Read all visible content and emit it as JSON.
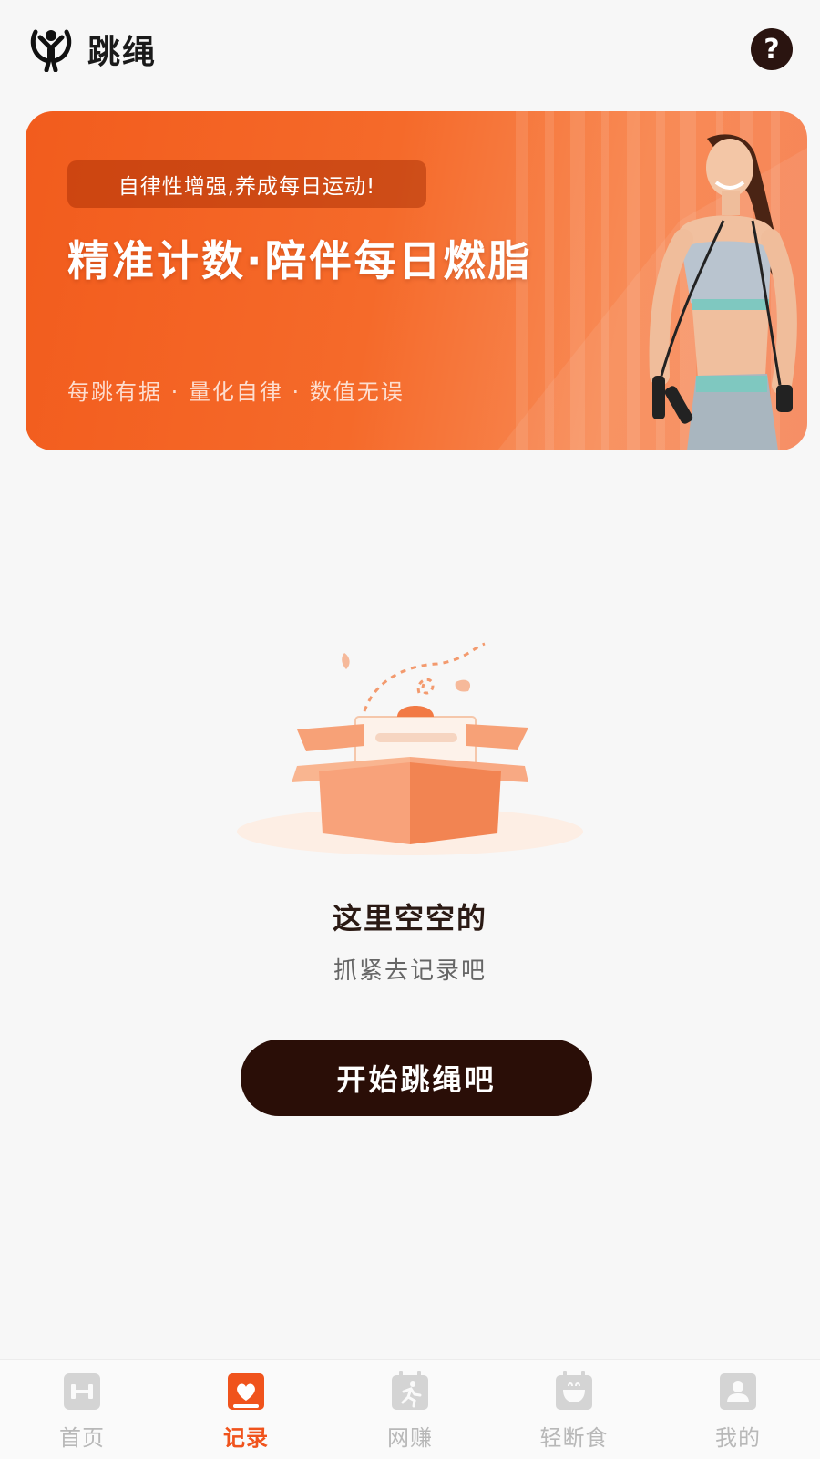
{
  "header": {
    "title": "跳绳",
    "logo_icon": "jump-rope-person-icon",
    "help_icon": "question-icon",
    "help_glyph": "?"
  },
  "banner": {
    "pill_text": "自律性增强,养成每日运动!",
    "headline": "精准计数·陪伴每日燃脂",
    "subline": "每跳有据 · 量化自律 · 数值无误",
    "accent_color": "#f25c1d"
  },
  "empty_state": {
    "title": "这里空空的",
    "subtitle": "抓紧去记录吧",
    "button_label": "开始跳绳吧"
  },
  "tabbar": {
    "active_color": "#f0531c",
    "inactive_color": "#b8b8b8",
    "tabs": [
      {
        "label": "首页",
        "icon": "dumbbell-icon",
        "active": false
      },
      {
        "label": "记录",
        "icon": "record-heart-icon",
        "active": true
      },
      {
        "label": "网赚",
        "icon": "runner-icon",
        "active": false
      },
      {
        "label": "轻断食",
        "icon": "bowl-icon",
        "active": false
      },
      {
        "label": "我的",
        "icon": "profile-icon",
        "active": false
      }
    ]
  }
}
